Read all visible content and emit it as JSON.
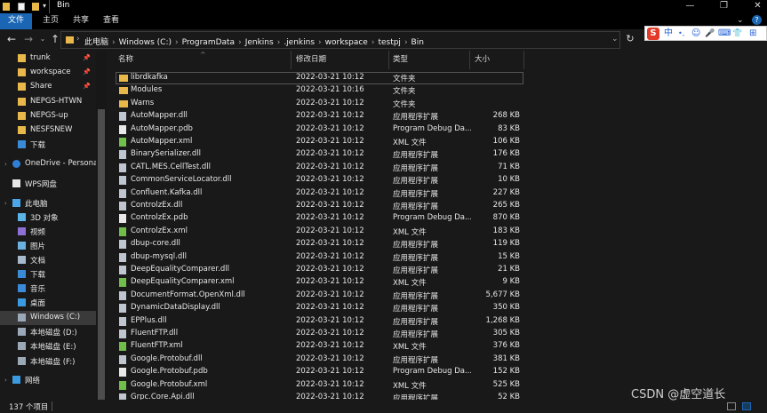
{
  "window": {
    "title": "Bin",
    "controls": [
      "—",
      "❐",
      "✕"
    ]
  },
  "ribbon": {
    "tabs": [
      "文件",
      "主页",
      "共享",
      "查看"
    ]
  },
  "address": {
    "crumbs": [
      "此电脑",
      "Windows (C:)",
      "ProgramData",
      "Jenkins",
      ".jenkins",
      "workspace",
      "testpj",
      "Bin"
    ],
    "refresh_icon": "refresh-icon"
  },
  "ime": {
    "logo": "S",
    "items": [
      "中",
      "•,",
      "☺",
      "🎤",
      "⌨",
      "👕",
      "⊞"
    ]
  },
  "sidebar": {
    "items": [
      {
        "label": "trunk",
        "icon": "folder",
        "pinned": true
      },
      {
        "label": "workspace",
        "icon": "folder",
        "pinned": true
      },
      {
        "label": "Share",
        "icon": "folder",
        "pinned": true
      },
      {
        "label": "NEPGS-HTWN",
        "icon": "folder",
        "pinned": false
      },
      {
        "label": "NEPGS-up",
        "icon": "folder",
        "pinned": false
      },
      {
        "label": "NESFSNEW",
        "icon": "folder",
        "pinned": false
      },
      {
        "label": "下载",
        "icon": "download",
        "pinned": false
      },
      {
        "label": "OneDrive - Personal",
        "icon": "cloud",
        "pinned": false
      },
      {
        "label": "WPS网盘",
        "icon": "wps",
        "pinned": false
      },
      {
        "label": "此电脑",
        "icon": "pc",
        "pinned": false
      },
      {
        "label": "3D 对象",
        "icon": "3d",
        "pinned": false
      },
      {
        "label": "视频",
        "icon": "video",
        "pinned": false
      },
      {
        "label": "图片",
        "icon": "picture",
        "pinned": false
      },
      {
        "label": "文档",
        "icon": "document",
        "pinned": false
      },
      {
        "label": "下载",
        "icon": "download",
        "pinned": false
      },
      {
        "label": "音乐",
        "icon": "music",
        "pinned": false
      },
      {
        "label": "桌面",
        "icon": "desktop",
        "pinned": false
      },
      {
        "label": "Windows (C:)",
        "icon": "drive",
        "pinned": false,
        "selected": true
      },
      {
        "label": "本地磁盘 (D:)",
        "icon": "drive",
        "pinned": false
      },
      {
        "label": "本地磁盘 (E:)",
        "icon": "drive",
        "pinned": false
      },
      {
        "label": "本地磁盘 (F:)",
        "icon": "drive",
        "pinned": false
      },
      {
        "label": "网络",
        "icon": "network",
        "pinned": false
      }
    ]
  },
  "filelist": {
    "columns": [
      "名称",
      "修改日期",
      "类型",
      "大小"
    ],
    "rows": [
      {
        "name": "librdkafka",
        "date": "2022-03-21 10:12",
        "type": "文件夹",
        "size": "",
        "icon": "folder"
      },
      {
        "name": "Modules",
        "date": "2022-03-21 10:16",
        "type": "文件夹",
        "size": "",
        "icon": "folder"
      },
      {
        "name": "Warns",
        "date": "2022-03-21 10:12",
        "type": "文件夹",
        "size": "",
        "icon": "folder"
      },
      {
        "name": "AutoMapper.dll",
        "date": "2022-03-21 10:12",
        "type": "应用程序扩展",
        "size": "268 KB",
        "icon": "dll"
      },
      {
        "name": "AutoMapper.pdb",
        "date": "2022-03-21 10:12",
        "type": "Program Debug Da...",
        "size": "83 KB",
        "icon": "file"
      },
      {
        "name": "AutoMapper.xml",
        "date": "2022-03-21 10:12",
        "type": "XML 文件",
        "size": "106 KB",
        "icon": "xml"
      },
      {
        "name": "BinarySerializer.dll",
        "date": "2022-03-21 10:12",
        "type": "应用程序扩展",
        "size": "176 KB",
        "icon": "dll"
      },
      {
        "name": "CATL.MES.CellTest.dll",
        "date": "2022-03-21 10:12",
        "type": "应用程序扩展",
        "size": "71 KB",
        "icon": "dll"
      },
      {
        "name": "CommonServiceLocator.dll",
        "date": "2022-03-21 10:12",
        "type": "应用程序扩展",
        "size": "10 KB",
        "icon": "dll"
      },
      {
        "name": "Confluent.Kafka.dll",
        "date": "2022-03-21 10:12",
        "type": "应用程序扩展",
        "size": "227 KB",
        "icon": "dll"
      },
      {
        "name": "ControlzEx.dll",
        "date": "2022-03-21 10:12",
        "type": "应用程序扩展",
        "size": "265 KB",
        "icon": "dll"
      },
      {
        "name": "ControlzEx.pdb",
        "date": "2022-03-21 10:12",
        "type": "Program Debug Da...",
        "size": "870 KB",
        "icon": "file"
      },
      {
        "name": "ControlzEx.xml",
        "date": "2022-03-21 10:12",
        "type": "XML 文件",
        "size": "183 KB",
        "icon": "xml"
      },
      {
        "name": "dbup-core.dll",
        "date": "2022-03-21 10:12",
        "type": "应用程序扩展",
        "size": "119 KB",
        "icon": "dll"
      },
      {
        "name": "dbup-mysql.dll",
        "date": "2022-03-21 10:12",
        "type": "应用程序扩展",
        "size": "15 KB",
        "icon": "dll"
      },
      {
        "name": "DeepEqualityComparer.dll",
        "date": "2022-03-21 10:12",
        "type": "应用程序扩展",
        "size": "21 KB",
        "icon": "dll"
      },
      {
        "name": "DeepEqualityComparer.xml",
        "date": "2022-03-21 10:12",
        "type": "XML 文件",
        "size": "9 KB",
        "icon": "xml"
      },
      {
        "name": "DocumentFormat.OpenXml.dll",
        "date": "2022-03-21 10:12",
        "type": "应用程序扩展",
        "size": "5,677 KB",
        "icon": "dll"
      },
      {
        "name": "DynamicDataDisplay.dll",
        "date": "2022-03-21 10:12",
        "type": "应用程序扩展",
        "size": "350 KB",
        "icon": "dll"
      },
      {
        "name": "EPPlus.dll",
        "date": "2022-03-21 10:12",
        "type": "应用程序扩展",
        "size": "1,268 KB",
        "icon": "dll"
      },
      {
        "name": "FluentFTP.dll",
        "date": "2022-03-21 10:12",
        "type": "应用程序扩展",
        "size": "305 KB",
        "icon": "dll"
      },
      {
        "name": "FluentFTP.xml",
        "date": "2022-03-21 10:12",
        "type": "XML 文件",
        "size": "376 KB",
        "icon": "xml"
      },
      {
        "name": "Google.Protobuf.dll",
        "date": "2022-03-21 10:12",
        "type": "应用程序扩展",
        "size": "381 KB",
        "icon": "dll"
      },
      {
        "name": "Google.Protobuf.pdb",
        "date": "2022-03-21 10:12",
        "type": "Program Debug Da...",
        "size": "152 KB",
        "icon": "file"
      },
      {
        "name": "Google.Protobuf.xml",
        "date": "2022-03-21 10:12",
        "type": "XML 文件",
        "size": "525 KB",
        "icon": "xml"
      },
      {
        "name": "Grpc.Core.Api.dll",
        "date": "2022-03-21 10:12",
        "type": "应用程序扩展",
        "size": "52 KB",
        "icon": "dll"
      }
    ]
  },
  "status": {
    "text": "137 个项目"
  },
  "watermark": "CSDN @虚空道长",
  "colors": {
    "accent": "#1a66b4",
    "folder": "#e8b84a",
    "background": "#191919"
  }
}
